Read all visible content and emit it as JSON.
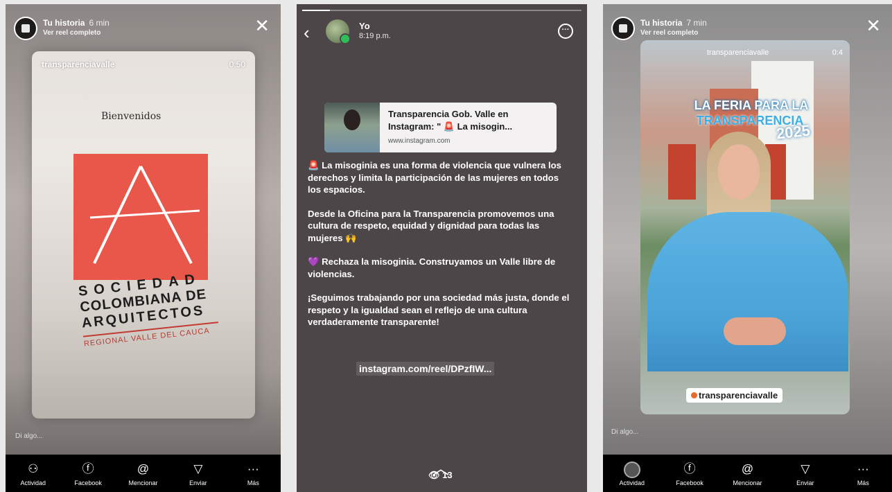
{
  "story_header": {
    "title": "Tu historia",
    "time_p1": "6 min",
    "time_p3": "7 min",
    "subtitle": "Ver reel completo",
    "close_glyph": "✕"
  },
  "panel1": {
    "reel_user": "transparenciavalle",
    "reel_duration": "0:50",
    "welcome": "Bienvenidos",
    "org_line1": "SOCIEDAD",
    "org_line2": "COLOMBIANA DE",
    "org_line3": "ARQUITECTOS",
    "org_line4": "REGIONAL VALLE DEL CAUCA",
    "logo_color": "#e8574a",
    "reply_placeholder": "Di algo..."
  },
  "bottom_bar": [
    {
      "icon": "people-icon",
      "glyph": "⚇",
      "label": "Actividad"
    },
    {
      "icon": "facebook-icon",
      "glyph": "ⓕ",
      "label": "Facebook"
    },
    {
      "icon": "mention-icon",
      "glyph": "@",
      "label": "Mencionar"
    },
    {
      "icon": "send-icon",
      "glyph": "▽",
      "label": "Enviar"
    },
    {
      "icon": "more-icon",
      "glyph": "···",
      "label": "Más"
    }
  ],
  "panel2": {
    "sender": "Yo",
    "time": "8:19 p.m.",
    "more_glyph": "···",
    "back_glyph": "‹",
    "link_card": {
      "title": "Transparencia Gob. Valle en Instagram: \" 🚨 La misogin...",
      "url": "www.instagram.com"
    },
    "paragraphs": [
      "🚨 La misoginia es una forma de violencia que vulnera los derechos y limita la participación de las mujeres en todos los espacios.",
      "Desde la Oficina para la Transparencia promovemos una cultura de respeto, equidad y dignidad para todas las mujeres 🙌",
      "💜 Rechaza la misoginia. Construyamos un Valle libre de violencias.",
      "¡Seguimos trabajando por una sociedad más justa, donde el respeto y la igualdad sean el reflejo de una cultura verdaderamente transparente!"
    ],
    "link_text": "instagram.com/reel/DPzfIW...",
    "up_glyph": "︿",
    "views": "👁 13",
    "bg_color": "#4d4649"
  },
  "panel3": {
    "reel_user": "transparenciavalle",
    "reel_duration": "0:4",
    "feria_line1": "LA FERIA PARA LA",
    "feria_line2": "TRANSPARENCIA",
    "feria_year": "2025",
    "mention_tag": "transparenciavalle",
    "reply_placeholder": "Di algo..."
  }
}
